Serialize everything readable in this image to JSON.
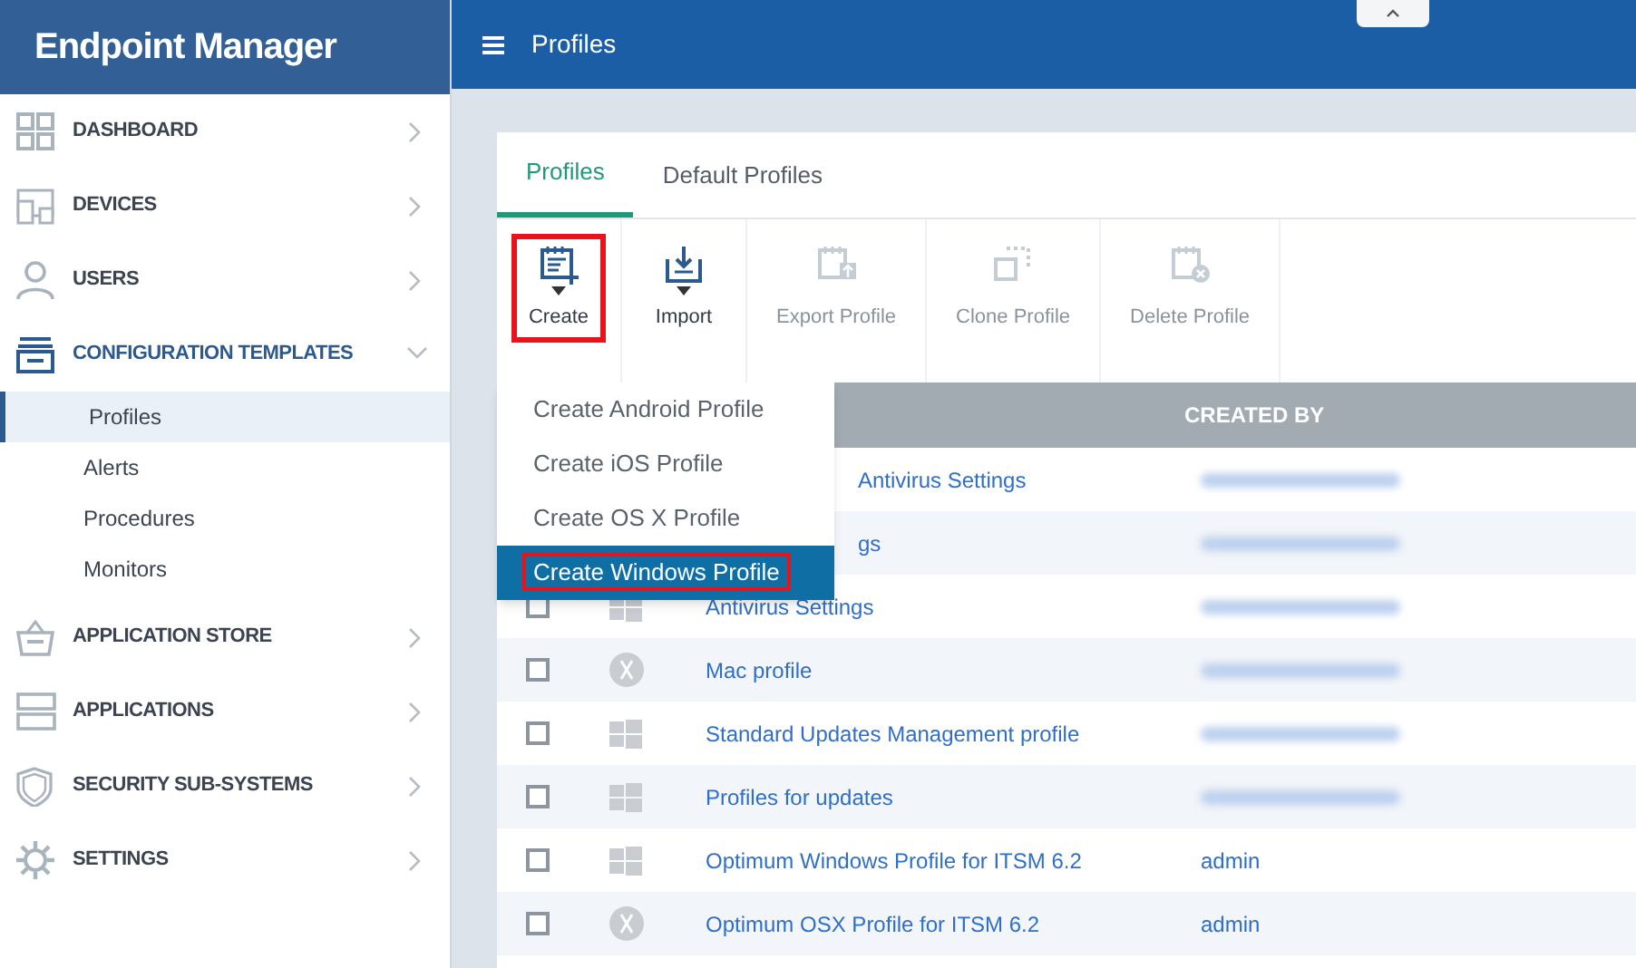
{
  "sidebar": {
    "title": "Endpoint Manager",
    "items": [
      {
        "label": "DASHBOARD",
        "expanded": false
      },
      {
        "label": "DEVICES",
        "expanded": false
      },
      {
        "label": "USERS",
        "expanded": false
      },
      {
        "label": "CONFIGURATION TEMPLATES",
        "expanded": true,
        "children": [
          {
            "label": "Profiles",
            "selected": true
          },
          {
            "label": "Alerts",
            "selected": false
          },
          {
            "label": "Procedures",
            "selected": false
          },
          {
            "label": "Monitors",
            "selected": false
          }
        ]
      },
      {
        "label": "APPLICATION STORE",
        "expanded": false
      },
      {
        "label": "APPLICATIONS",
        "expanded": false
      },
      {
        "label": "SECURITY SUB-SYSTEMS",
        "expanded": false
      },
      {
        "label": "SETTINGS",
        "expanded": false
      }
    ]
  },
  "header": {
    "title": "Profiles"
  },
  "tabs": [
    {
      "label": "Profiles",
      "selected": true
    },
    {
      "label": "Default Profiles",
      "selected": false
    }
  ],
  "toolbar": [
    {
      "label": "Create",
      "disabled": false,
      "dropdown": true,
      "highlighted": true
    },
    {
      "label": "Import",
      "disabled": false,
      "dropdown": true,
      "highlighted": false
    },
    {
      "label": "Export Profile",
      "disabled": true,
      "dropdown": false,
      "highlighted": false
    },
    {
      "label": "Clone Profile",
      "disabled": true,
      "dropdown": false,
      "highlighted": false
    },
    {
      "label": "Delete Profile",
      "disabled": true,
      "dropdown": false,
      "highlighted": false
    }
  ],
  "menu": [
    {
      "label": "Create Android Profile",
      "selected": false
    },
    {
      "label": "Create iOS Profile",
      "selected": false
    },
    {
      "label": "Create OS X Profile",
      "selected": false
    },
    {
      "label": "Create Windows Profile",
      "selected": true
    }
  ],
  "table": {
    "columns": [
      "CREATED BY"
    ],
    "rows": [
      {
        "name": "Antivirus Settings"
      },
      {
        "name": "gs"
      },
      {
        "name": "Antivirus Settings",
        "kind": "windows",
        "checked": false
      },
      {
        "name": "Mac profile",
        "kind": "mac",
        "checked": false
      },
      {
        "name": "Standard Updates Management profile",
        "kind": "windows",
        "checked": false
      },
      {
        "name": "Profiles for updates",
        "kind": "windows",
        "checked": false
      },
      {
        "name": "Optimum Windows Profile for ITSM 6.2",
        "kind": "windows",
        "created_by": "admin",
        "checked": false
      },
      {
        "name": "Optimum OSX Profile for ITSM 6.2",
        "kind": "mac",
        "created_by": "admin",
        "checked": false
      }
    ]
  }
}
